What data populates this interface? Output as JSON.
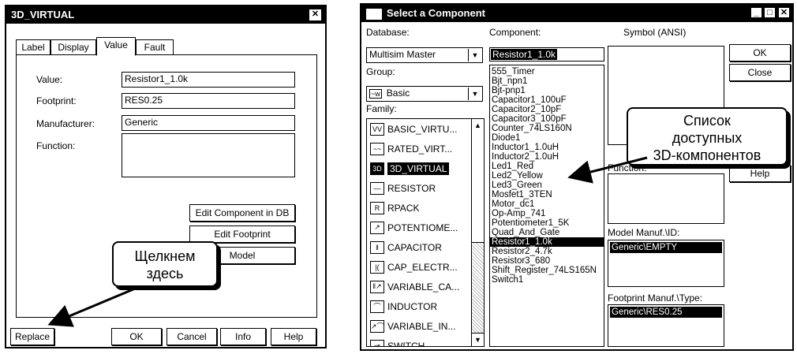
{
  "left_dialog": {
    "title": "3D_VIRTUAL",
    "close": "✕",
    "tabs": [
      "Label",
      "Display",
      "Value",
      "Fault"
    ],
    "fields": [
      {
        "label": "Value:",
        "value": "Resistor1_1.0k"
      },
      {
        "label": "Footprint:",
        "value": "RES0.25"
      },
      {
        "label": "Manufacturer:",
        "value": "Generic"
      },
      {
        "label": "Function:",
        "value": ""
      }
    ],
    "buttons": {
      "edit_component": "Edit Component in DB",
      "edit_footprint": "Edit Footprint",
      "edit_model": "Model",
      "replace": "Replace",
      "ok": "OK",
      "cancel": "Cancel",
      "info": "Info",
      "help": "Help"
    },
    "callout": [
      "Щелкнем",
      "здесь"
    ]
  },
  "right_dialog": {
    "title": "Select a Component",
    "title_buttons": [
      "_",
      "□",
      "✕"
    ],
    "database_label": "Database:",
    "database_value": "Multisim Master",
    "group_label": "Group:",
    "group_value": "Basic",
    "family_label": "Family:",
    "families": [
      "BASIC_VIRTU...",
      "RATED_VIRT...",
      "3D_VIRTUAL",
      "RESISTOR",
      "RPACK",
      "POTENTIOME...",
      "CAPACITOR",
      "CAP_ELECTR...",
      "VARIABLE_CA...",
      "INDUCTOR",
      "VARIABLE_IN...",
      "SWITCH"
    ],
    "family_icons": [
      "VV",
      "~~",
      "3D",
      "—",
      "R",
      "↗",
      "‖",
      "|(",
      "‖↗",
      "⌒",
      "↗⌒",
      "⊸"
    ],
    "family_selected": 2,
    "component_label": "Component:",
    "component_value": "Resistor1_1.0k",
    "components": [
      "555_Timer",
      "Bjt_npn1",
      "Bjt-pnp1",
      "Capacitor1_100uF",
      "Capacitor2_10pF",
      "Capacitor3_100pF",
      "Counter_74LS160N",
      "Diode1",
      "Inductor1_1.0uH",
      "Inductor2_1.0uH",
      "Led1_Red",
      "Led2_Yellow",
      "Led3_Green",
      "Mosfet1_3TEN",
      "Motor_dc1",
      "Op-Amp_741",
      "Potentiometer1_5K",
      "Quad_And_Gate",
      "Resistor1_1.0k",
      "Resistor2_4.7k",
      "Resistor3_680",
      "Shift_Register_74LS165N",
      "Switch1"
    ],
    "component_selected": 18,
    "symbol_label": "Symbol (ANSI)",
    "buttons": {
      "ok": "OK",
      "close": "Close",
      "help": "Help"
    },
    "function_label": "Function:",
    "model_manuf_label": "Model Manuf.\\ID:",
    "model_manuf_value": "Generic\\EMPTY",
    "footprint_label": "Footprint Manuf.\\Type:",
    "footprint_value": "Generic\\RES0.25",
    "callout": [
      "Список",
      "доступных",
      "3D-компонентов"
    ]
  }
}
